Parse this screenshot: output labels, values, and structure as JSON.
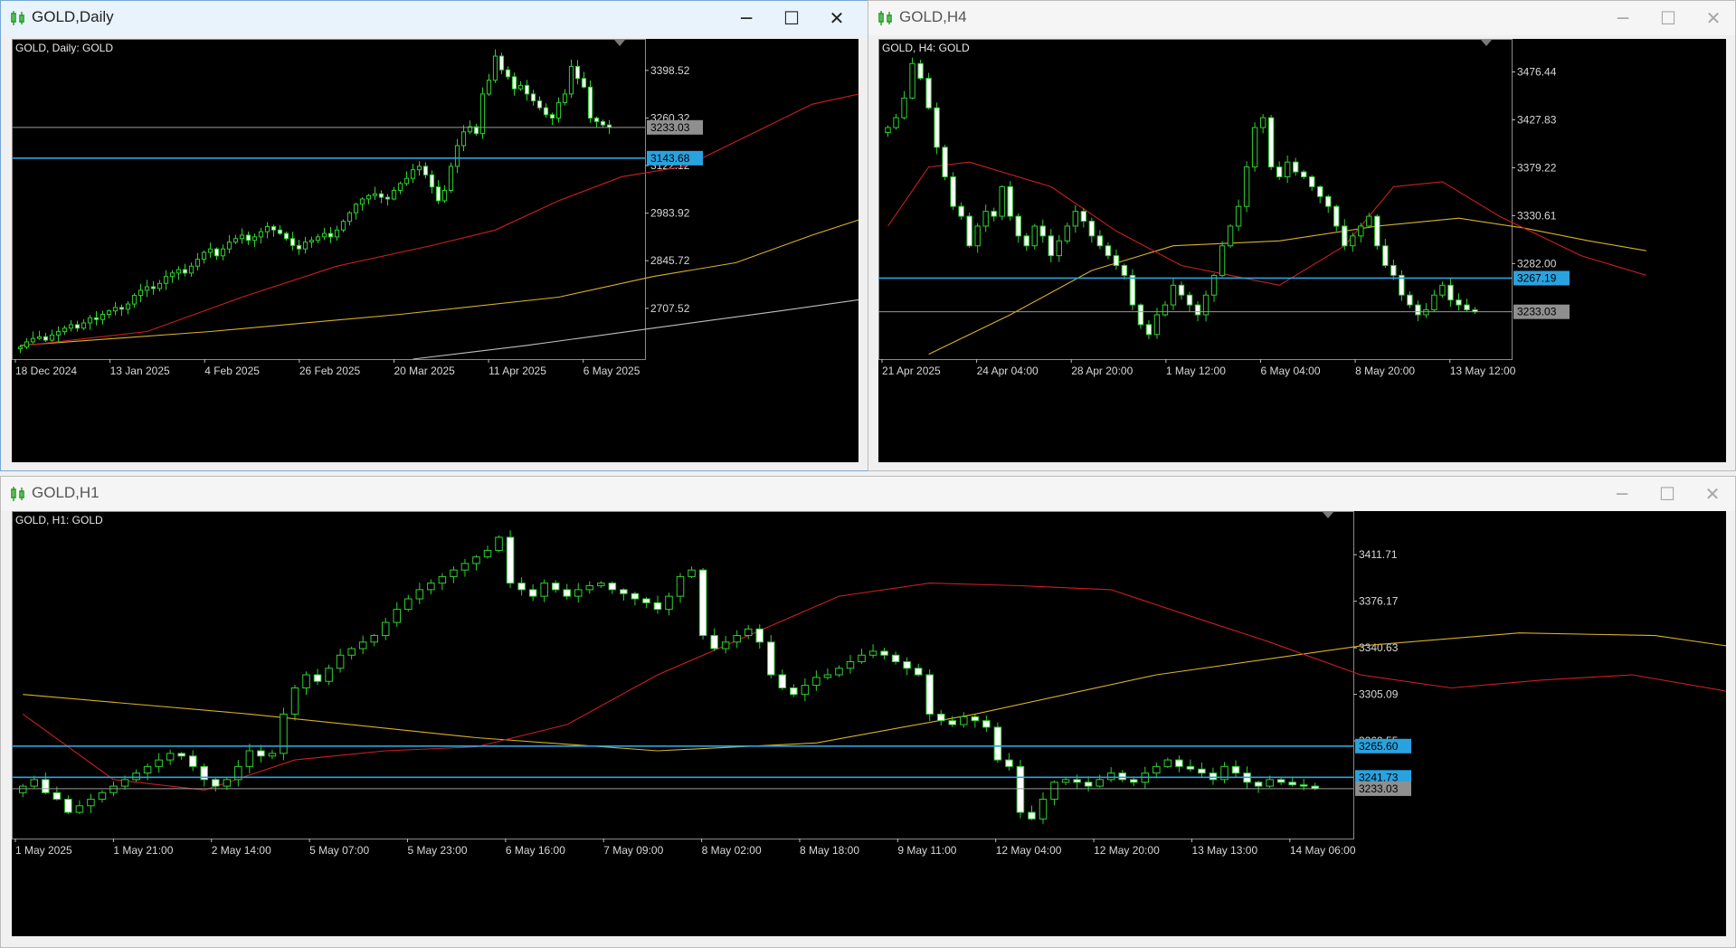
{
  "windows": [
    {
      "id": "daily",
      "title": "GOLD,Daily",
      "active": true,
      "chart_label": "GOLD, Daily:  GOLD",
      "controls": {
        "minimize": "─",
        "maximize": "☐",
        "close": "✕"
      },
      "chart_data": {
        "type": "candlestick",
        "symbol": "GOLD",
        "timeframe": "Daily",
        "ylim": [
          2560,
          3490
        ],
        "y_ticks": [
          3398.52,
          3260.32,
          3122.12,
          2983.92,
          2845.72,
          2707.52
        ],
        "x_labels": [
          "18 Dec 2024",
          "13 Jan 2025",
          "4 Feb 2025",
          "26 Feb 2025",
          "20 Mar 2025",
          "11 Apr 2025",
          "6 May 2025"
        ],
        "bid_price": "3233.03",
        "horizontal_lines": [
          {
            "label": "3143.68",
            "value": 3143.68,
            "color": "#29a3e0"
          }
        ],
        "closes": [
          2595,
          2610,
          2620,
          2625,
          2615,
          2630,
          2640,
          2650,
          2660,
          2650,
          2665,
          2680,
          2675,
          2690,
          2700,
          2710,
          2705,
          2720,
          2745,
          2760,
          2770,
          2765,
          2780,
          2800,
          2810,
          2820,
          2810,
          2830,
          2850,
          2870,
          2880,
          2860,
          2880,
          2900,
          2910,
          2920,
          2905,
          2915,
          2930,
          2945,
          2935,
          2925,
          2910,
          2890,
          2880,
          2900,
          2905,
          2915,
          2925,
          2915,
          2935,
          2960,
          2985,
          3010,
          3025,
          3035,
          3040,
          3030,
          3025,
          3050,
          3070,
          3085,
          3110,
          3120,
          3095,
          3060,
          3020,
          3050,
          3120,
          3180,
          3220,
          3235,
          3215,
          3330,
          3370,
          3440,
          3400,
          3380,
          3345,
          3355,
          3330,
          3310,
          3290,
          3270,
          3260,
          3305,
          3330,
          3410,
          3375,
          3350,
          3260,
          3250,
          3240,
          3233.03
        ],
        "ma_fast": {
          "color": "#cc1f1f",
          "points": [
            [
              0,
              2598
            ],
            [
              20,
              2640
            ],
            [
              35,
              2740
            ],
            [
              50,
              2830
            ],
            [
              65,
              2890
            ],
            [
              75,
              2935
            ],
            [
              85,
              3020
            ],
            [
              95,
              3090
            ],
            [
              105,
              3120
            ],
            [
              115,
              3210
            ],
            [
              125,
              3300
            ],
            [
              135,
              3340
            ],
            [
              143,
              3358
            ]
          ]
        },
        "ma_mid": {
          "color": "#d8b12a",
          "points": [
            [
              0,
              2600
            ],
            [
              30,
              2640
            ],
            [
              60,
              2690
            ],
            [
              85,
              2740
            ],
            [
              100,
              2800
            ],
            [
              113,
              2840
            ],
            [
              125,
              2920
            ],
            [
              135,
              2980
            ],
            [
              143,
              3020
            ]
          ]
        },
        "ma_slow": {
          "color": "#bfbfbf",
          "points": [
            [
              62,
              2560
            ],
            [
              80,
              2600
            ],
            [
              100,
              2650
            ],
            [
              120,
              2700
            ],
            [
              143,
              2760
            ]
          ]
        }
      }
    },
    {
      "id": "h4",
      "title": "GOLD,H4",
      "active": false,
      "chart_label": "GOLD, H4:  GOLD",
      "controls": {
        "minimize": "─",
        "maximize": "☐",
        "close": "✕"
      },
      "chart_data": {
        "type": "candlestick",
        "symbol": "GOLD",
        "timeframe": "H4",
        "ylim": [
          3185,
          3510
        ],
        "y_ticks": [
          3476.44,
          3427.83,
          3379.22,
          3330.61,
          3282.0
        ],
        "x_labels": [
          "21 Apr 2025",
          "24 Apr 04:00",
          "28 Apr 20:00",
          "1 May 12:00",
          "6 May 04:00",
          "8 May 20:00",
          "13 May 12:00"
        ],
        "bid_price": "3233.03",
        "horizontal_lines": [
          {
            "label": "3267.19",
            "value": 3267.19,
            "color": "#29a3e0"
          }
        ],
        "closes": [
          3420,
          3430,
          3450,
          3485,
          3470,
          3440,
          3400,
          3370,
          3340,
          3330,
          3300,
          3320,
          3335,
          3330,
          3360,
          3330,
          3310,
          3300,
          3320,
          3310,
          3290,
          3305,
          3320,
          3335,
          3325,
          3310,
          3300,
          3290,
          3280,
          3270,
          3240,
          3220,
          3210,
          3230,
          3240,
          3260,
          3250,
          3240,
          3230,
          3250,
          3270,
          3300,
          3320,
          3340,
          3380,
          3420,
          3430,
          3380,
          3370,
          3385,
          3375,
          3370,
          3360,
          3350,
          3340,
          3320,
          3300,
          3310,
          3320,
          3330,
          3300,
          3280,
          3270,
          3250,
          3240,
          3230,
          3235,
          3250,
          3260,
          3245,
          3240,
          3235,
          3233.03
        ],
        "ma_fast": {
          "color": "#cc1f1f",
          "points": [
            [
              0,
              3320
            ],
            [
              5,
              3380
            ],
            [
              10,
              3385
            ],
            [
              20,
              3360
            ],
            [
              28,
              3315
            ],
            [
              36,
              3280
            ],
            [
              42,
              3270
            ],
            [
              48,
              3260
            ],
            [
              56,
              3300
            ],
            [
              62,
              3360
            ],
            [
              68,
              3365
            ],
            [
              75,
              3330
            ],
            [
              85,
              3290
            ],
            [
              93,
              3270
            ]
          ]
        },
        "ma_mid": {
          "color": "#d8b12a",
          "points": [
            [
              5,
              3190
            ],
            [
              15,
              3230
            ],
            [
              25,
              3275
            ],
            [
              35,
              3300
            ],
            [
              48,
              3305
            ],
            [
              60,
              3320
            ],
            [
              70,
              3328
            ],
            [
              78,
              3318
            ],
            [
              86,
              3305
            ],
            [
              93,
              3295
            ]
          ]
        }
      }
    },
    {
      "id": "h1",
      "title": "GOLD,H1",
      "active": false,
      "chart_label": "GOLD, H1:  GOLD",
      "controls": {
        "minimize": "─",
        "maximize": "☐",
        "close": "✕"
      },
      "chart_data": {
        "type": "candlestick",
        "symbol": "GOLD",
        "timeframe": "H1",
        "ylim": [
          3195,
          3445
        ],
        "y_ticks": [
          3411.71,
          3376.17,
          3340.63,
          3305.09,
          3269.55
        ],
        "x_labels": [
          "1 May 2025",
          "1 May 21:00",
          "2 May 14:00",
          "5 May 07:00",
          "5 May 23:00",
          "6 May 16:00",
          "7 May 09:00",
          "8 May 02:00",
          "8 May 18:00",
          "9 May 11:00",
          "12 May 04:00",
          "12 May 20:00",
          "13 May 13:00",
          "14 May 06:00"
        ],
        "bid_price": "3233.03",
        "horizontal_lines": [
          {
            "label": "3265.60",
            "value": 3265.6,
            "color": "#29a3e0"
          },
          {
            "label": "3241.73",
            "value": 3241.73,
            "color": "#29a3e0"
          }
        ],
        "closes": [
          3235,
          3240,
          3230,
          3225,
          3215,
          3220,
          3225,
          3230,
          3235,
          3240,
          3245,
          3250,
          3255,
          3260,
          3258,
          3250,
          3240,
          3235,
          3240,
          3250,
          3262,
          3258,
          3260,
          3290,
          3310,
          3320,
          3315,
          3325,
          3335,
          3340,
          3345,
          3350,
          3360,
          3370,
          3378,
          3385,
          3390,
          3395,
          3400,
          3405,
          3410,
          3415,
          3425,
          3390,
          3385,
          3380,
          3390,
          3385,
          3380,
          3385,
          3388,
          3390,
          3385,
          3382,
          3378,
          3375,
          3370,
          3380,
          3395,
          3400,
          3350,
          3340,
          3345,
          3350,
          3355,
          3345,
          3320,
          3310,
          3305,
          3312,
          3318,
          3320,
          3325,
          3330,
          3335,
          3338,
          3335,
          3330,
          3325,
          3320,
          3290,
          3285,
          3282,
          3288,
          3285,
          3280,
          3255,
          3250,
          3215,
          3210,
          3225,
          3238,
          3240,
          3238,
          3235,
          3240,
          3245,
          3240,
          3238,
          3245,
          3250,
          3255,
          3250,
          3248,
          3245,
          3240,
          3250,
          3245,
          3238,
          3235,
          3240,
          3238,
          3236,
          3235,
          3233.03
        ],
        "ma_fast": {
          "color": "#cc1f1f",
          "points": [
            [
              0,
              3290
            ],
            [
              8,
              3240
            ],
            [
              16,
              3232
            ],
            [
              24,
              3255
            ],
            [
              32,
              3262
            ],
            [
              40,
              3265
            ],
            [
              48,
              3282
            ],
            [
              56,
              3320
            ],
            [
              64,
              3350
            ],
            [
              72,
              3380
            ],
            [
              80,
              3390
            ],
            [
              88,
              3388
            ],
            [
              96,
              3385
            ],
            [
              104,
              3362
            ],
            [
              110,
              3345
            ],
            [
              118,
              3320
            ],
            [
              126,
              3310
            ],
            [
              134,
              3316
            ],
            [
              142,
              3320
            ],
            [
              150,
              3308
            ],
            [
              158,
              3285
            ],
            [
              164,
              3248
            ],
            [
              170,
              3238
            ],
            [
              178,
              3238
            ],
            [
              186,
              3245
            ],
            [
              194,
              3246
            ],
            [
              202,
              3246
            ],
            [
              210,
              3242
            ]
          ]
        },
        "ma_mid": {
          "color": "#d8b12a",
          "points": [
            [
              0,
              3305
            ],
            [
              20,
              3290
            ],
            [
              40,
              3272
            ],
            [
              56,
              3262
            ],
            [
              70,
              3268
            ],
            [
              84,
              3290
            ],
            [
              100,
              3320
            ],
            [
              118,
              3342
            ],
            [
              132,
              3352
            ],
            [
              144,
              3350
            ],
            [
              156,
              3335
            ],
            [
              170,
              3310
            ],
            [
              184,
              3290
            ],
            [
              198,
              3275
            ],
            [
              210,
              3266
            ]
          ]
        }
      }
    }
  ]
}
